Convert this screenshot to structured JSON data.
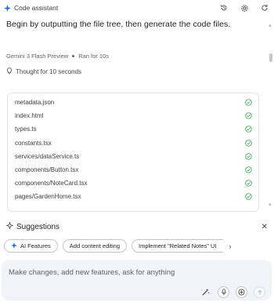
{
  "header": {
    "title": "Code assistant",
    "icons": [
      "sparkle-icon",
      "history-icon",
      "settings-icon",
      "refresh-icon"
    ]
  },
  "prompt": "Begin by outputting the file tree, then generate the code files.",
  "meta": {
    "model": "Gemini 3 Flash Preview",
    "runtime": "Ran for 10s"
  },
  "thought": "Thought for 10 seconds",
  "files": [
    {
      "name": "metadata.json",
      "status": "done"
    },
    {
      "name": "index.html",
      "status": "done"
    },
    {
      "name": "types.ts",
      "status": "done"
    },
    {
      "name": "constants.tsx",
      "status": "done"
    },
    {
      "name": "services/dataService.ts",
      "status": "done"
    },
    {
      "name": "components/Button.tsx",
      "status": "done"
    },
    {
      "name": "components/NoteCard.tsx",
      "status": "done"
    },
    {
      "name": "pages/GardenHome.tsx",
      "status": "done"
    }
  ],
  "suggestions": {
    "title": "Suggestions",
    "chips": [
      "AI Features",
      "Add content editing",
      "Implement \"Related Notes\" UI"
    ]
  },
  "composer": {
    "placeholder": "Make changes, add new features, ask for anything"
  },
  "colors": {
    "accent": "#1a73e8",
    "check": "#34a853"
  }
}
